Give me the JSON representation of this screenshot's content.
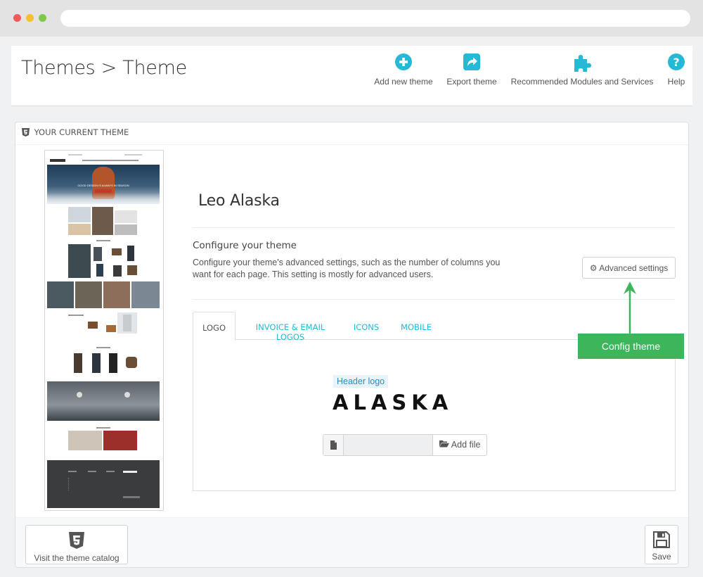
{
  "header": {
    "title": "Themes > Theme",
    "toolbar": {
      "add_new_theme": "Add new theme",
      "export_theme": "Export theme",
      "recommended": "Recommended Modules and Services",
      "help": "Help"
    }
  },
  "panel": {
    "heading": "YOUR CURRENT THEME",
    "theme_name": "Leo Alaska",
    "configure_title": "Configure your theme",
    "configure_desc": "Configure your theme's advanced settings, such as the number of columns you want for each page. This setting is mostly for advanced users.",
    "advanced_settings_label": "Advanced settings",
    "tabs": [
      "LOGO",
      "INVOICE & EMAIL LOGOS",
      "ICONS",
      "MOBILE"
    ],
    "active_tab": "LOGO",
    "logo_section": {
      "label": "Header logo",
      "logo_text": "ALASKA",
      "add_file_label": "Add file"
    },
    "preview": {
      "hero_text": "GOOD DESIGN IS ALWAYS IN SEASON"
    }
  },
  "callout": {
    "text": "Config theme",
    "color": "#3db65b"
  },
  "footer": {
    "catalog_label": "Visit the theme catalog",
    "save_label": "Save"
  },
  "colors": {
    "accent": "#25b9d7",
    "callout": "#3db65b"
  }
}
